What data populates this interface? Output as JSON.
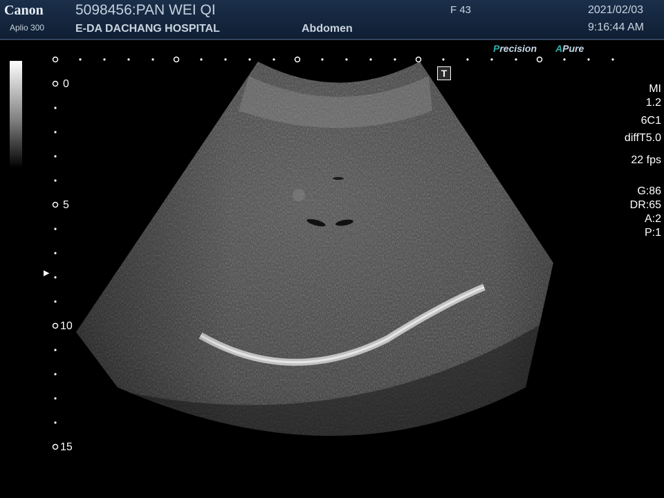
{
  "header": {
    "brand": "Canon",
    "model": "Aplio 300",
    "patient": "5098456:PAN WEI QI",
    "hospital": "E-DA DACHANG HOSPITAL",
    "exam": "Abdomen",
    "sex_age": "F  43",
    "date": "2021/02/03",
    "time": "9:16:44 AM"
  },
  "image_labels": {
    "precision_first": "P",
    "precision_rest": "recision",
    "apure_first": "A",
    "apure_rest": "Pure",
    "t_marker": "T"
  },
  "depth_scale": [
    "0",
    "5",
    "10",
    "15"
  ],
  "params": {
    "mi_label": "MI",
    "mi_value": "1.2",
    "probe": "6C1",
    "mode": "diffT5.0",
    "frame_rate": "22 fps",
    "gain": "G:86",
    "dynamic_range": "DR:65",
    "a": "A:2",
    "p": "P:1"
  },
  "colors": {
    "header_bg": "#1b2f4a",
    "accent_teal": "#2fb0ac",
    "text": "#c9d3df"
  }
}
